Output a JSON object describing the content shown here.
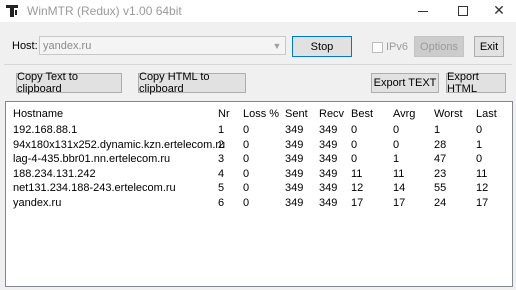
{
  "window": {
    "title": "WinMTR (Redux) v1.00 64bit"
  },
  "toolbar": {
    "host_label": "Host:",
    "host_value": "yandex.ru",
    "stop_label": "Stop",
    "ipv6_label": "IPv6",
    "options_label": "Options",
    "exit_label": "Exit",
    "copy_text_label": "Copy Text to clipboard",
    "copy_html_label": "Copy HTML to clipboard",
    "export_text_label": "Export TEXT",
    "export_html_label": "Export HTML"
  },
  "table": {
    "headers": [
      "Hostname",
      "Nr",
      "Loss %",
      "Sent",
      "Recv",
      "Best",
      "Avrg",
      "Worst",
      "Last"
    ],
    "rows": [
      [
        "192.168.88.1",
        "1",
        "0",
        "349",
        "349",
        "0",
        "0",
        "1",
        "0"
      ],
      [
        "94x180x131x252.dynamic.kzn.ertelecom.ru",
        "2",
        "0",
        "349",
        "349",
        "0",
        "0",
        "28",
        "1"
      ],
      [
        "lag-4-435.bbr01.nn.ertelecom.ru",
        "3",
        "0",
        "349",
        "349",
        "0",
        "1",
        "47",
        "0"
      ],
      [
        "188.234.131.242",
        "4",
        "0",
        "349",
        "349",
        "11",
        "11",
        "23",
        "11"
      ],
      [
        "net131.234.188-243.ertelecom.ru",
        "5",
        "0",
        "349",
        "349",
        "12",
        "14",
        "55",
        "12"
      ],
      [
        "yandex.ru",
        "6",
        "0",
        "349",
        "349",
        "17",
        "17",
        "24",
        "17"
      ]
    ]
  },
  "icons": {
    "app": "winmtr-t-icon",
    "minimize": "minimize-icon",
    "maximize": "maximize-icon",
    "close": "close-icon",
    "combo": "chevron-down-icon"
  }
}
